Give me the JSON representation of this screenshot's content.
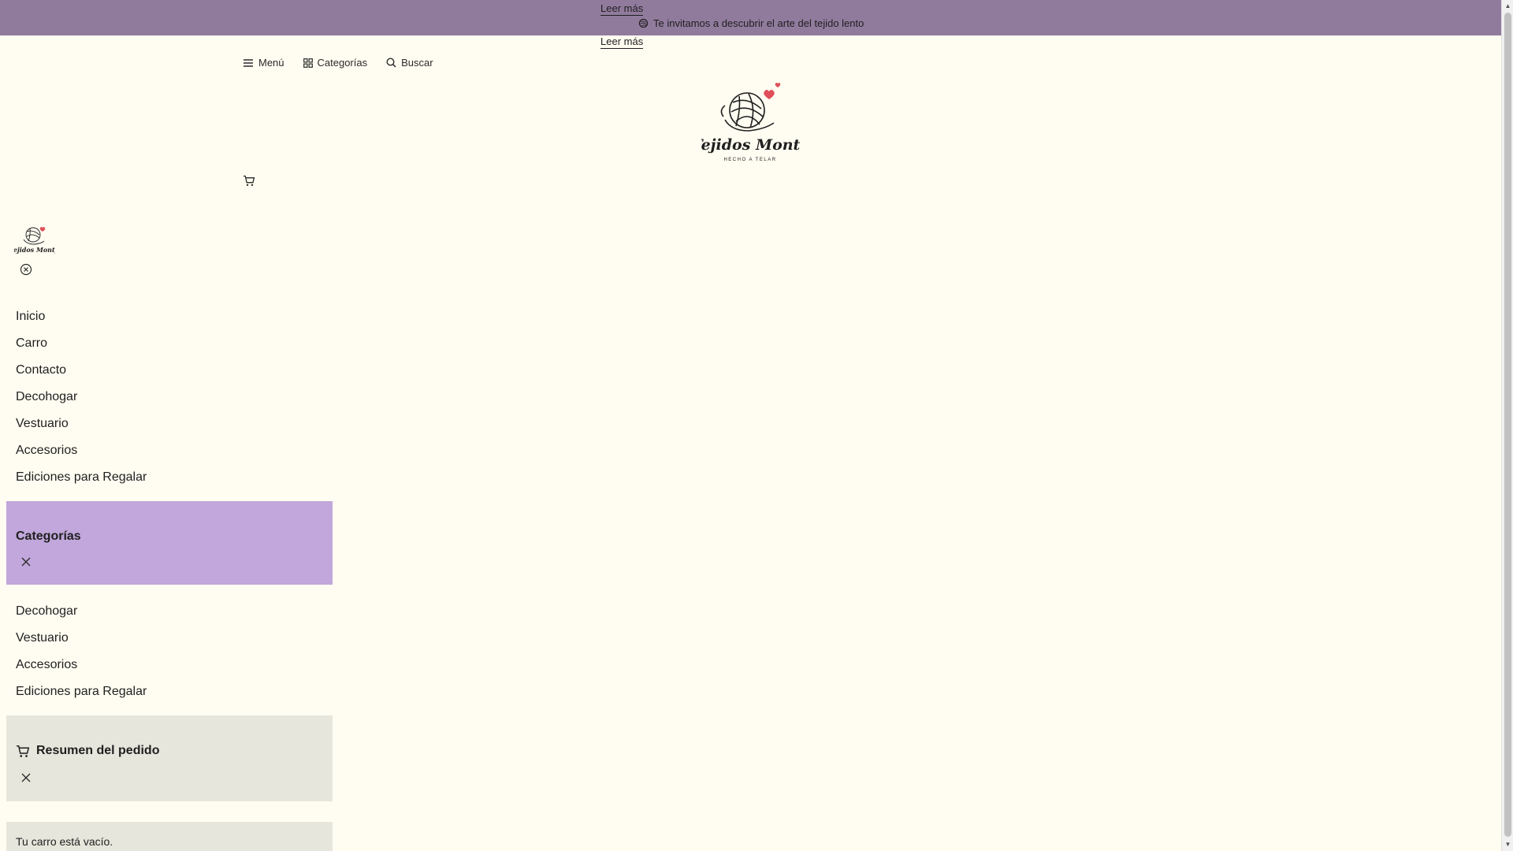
{
  "announcement": {
    "link_top": "Leer más",
    "message": "Te invitamos a descubrir el arte del tejido lento",
    "link_bottom": "Leer más"
  },
  "header": {
    "menu_label": "Menú",
    "categories_label": "Categorías",
    "search_label": "Buscar",
    "logo_text": "Tejidos Monty",
    "logo_subtext": "HECHO A TELAR"
  },
  "drawer": {
    "nav_items": [
      "Inicio",
      "Carro",
      "Contacto",
      "Decohogar",
      "Vestuario",
      "Accesorios",
      "Ediciones para Regalar"
    ],
    "categories_title": "Categorías",
    "category_items": [
      "Decohogar",
      "Vestuario",
      "Accesorios",
      "Ediciones para Regalar"
    ],
    "order_title": "Resumen del pedido",
    "cart_empty": "Tu carro está vacío."
  },
  "colors": {
    "announcement_bg": "#917b9d",
    "page_bg": "#fffdf1",
    "categories_panel_bg": "#c1a7db",
    "order_panel_bg": "#e6e6dc",
    "heart_accent": "#e0505a"
  }
}
